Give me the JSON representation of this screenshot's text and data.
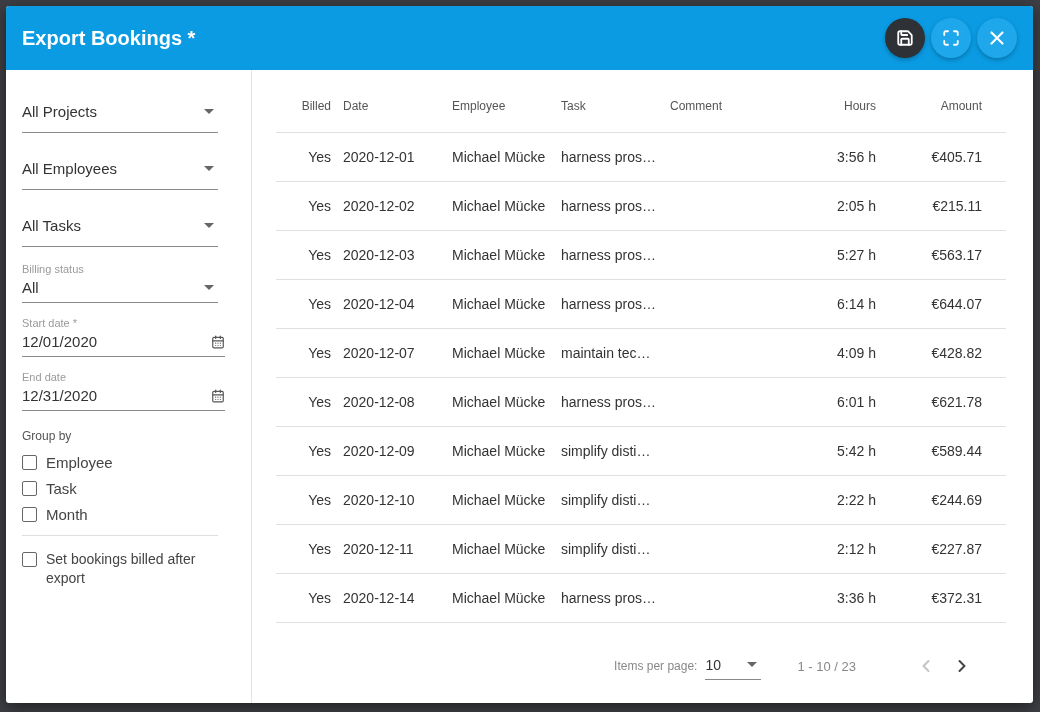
{
  "dialog": {
    "title": "Export Bookings *"
  },
  "header_buttons": [
    {
      "kind": "save"
    },
    {
      "kind": "fullscreen"
    },
    {
      "kind": "close"
    }
  ],
  "filters": [
    {
      "kind": "select",
      "value": "All Projects"
    },
    {
      "kind": "select",
      "value": "All Employees"
    },
    {
      "kind": "select",
      "value": "All Tasks"
    },
    {
      "kind": "select",
      "label": "Billing status",
      "value": "All"
    },
    {
      "kind": "date",
      "label": "Start date *",
      "value": "12/01/2020"
    },
    {
      "kind": "date",
      "label": "End date",
      "value": "12/31/2020"
    }
  ],
  "group_by": {
    "label": "Group by",
    "options": [
      {
        "label": "Employee",
        "checked": false
      },
      {
        "label": "Task",
        "checked": false
      },
      {
        "label": "Month",
        "checked": false
      }
    ]
  },
  "bill_after_export": {
    "label": "Set bookings billed after export",
    "checked": false
  },
  "table": {
    "columns": [
      "Billed",
      "Date",
      "Employee",
      "Task",
      "Comment",
      "Hours",
      "Amount"
    ],
    "rows": [
      [
        "Yes",
        "2020-12-01",
        "Michael Mücke",
        "harness pros…",
        "",
        "3:56 h",
        "€405.71"
      ],
      [
        "Yes",
        "2020-12-02",
        "Michael Mücke",
        "harness pros…",
        "",
        "2:05 h",
        "€215.11"
      ],
      [
        "Yes",
        "2020-12-03",
        "Michael Mücke",
        "harness pros…",
        "",
        "5:27 h",
        "€563.17"
      ],
      [
        "Yes",
        "2020-12-04",
        "Michael Mücke",
        "harness pros…",
        "",
        "6:14 h",
        "€644.07"
      ],
      [
        "Yes",
        "2020-12-07",
        "Michael Mücke",
        "maintain tec…",
        "",
        "4:09 h",
        "€428.82"
      ],
      [
        "Yes",
        "2020-12-08",
        "Michael Mücke",
        "harness pros…",
        "",
        "6:01 h",
        "€621.78"
      ],
      [
        "Yes",
        "2020-12-09",
        "Michael Mücke",
        "simplify disti…",
        "",
        "5:42 h",
        "€589.44"
      ],
      [
        "Yes",
        "2020-12-10",
        "Michael Mücke",
        "simplify disti…",
        "",
        "2:22 h",
        "€244.69"
      ],
      [
        "Yes",
        "2020-12-11",
        "Michael Mücke",
        "simplify disti…",
        "",
        "2:12 h",
        "€227.87"
      ],
      [
        "Yes",
        "2020-12-14",
        "Michael Mücke",
        "harness pros…",
        "",
        "3:36 h",
        "€372.31"
      ]
    ]
  },
  "pagination": {
    "items_per_page_label": "Items per page:",
    "items_per_page": "10",
    "range": "1 - 10 / 23",
    "previous_disabled": true,
    "next_disabled": false
  }
}
